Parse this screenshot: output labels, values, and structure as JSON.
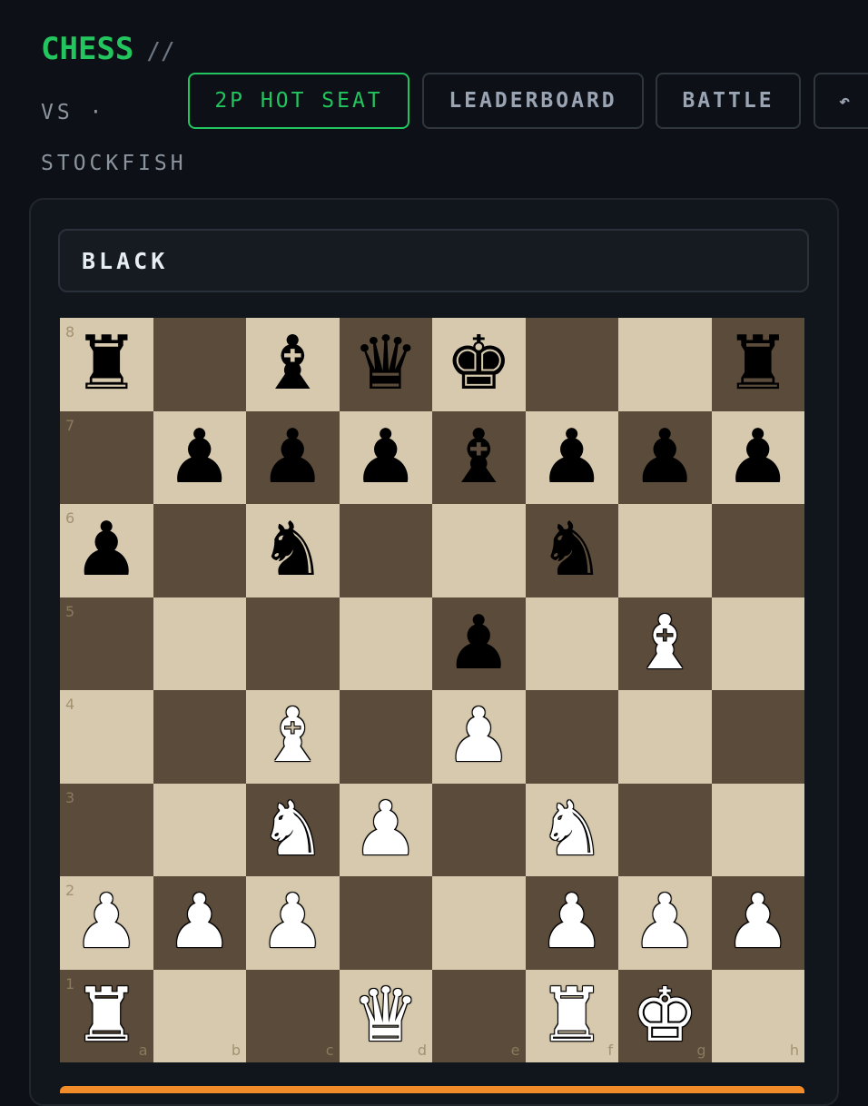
{
  "header": {
    "brand": "CHESS",
    "brand_sep": "//",
    "subtitle": "VS · STOCKFISH"
  },
  "nav": {
    "hot_seat": "2P HOT SEAT",
    "leaderboard": "LEADERBOARD",
    "battle": "BATTLE",
    "undo": "↶"
  },
  "game": {
    "turn_label": "BLACK"
  },
  "colors": {
    "accent": "#22c55e",
    "light_square": "#d6c9ad",
    "dark_square": "#5b4b3a",
    "warning": "#f28c28"
  },
  "board": {
    "files": [
      "a",
      "b",
      "c",
      "d",
      "e",
      "f",
      "g",
      "h"
    ],
    "ranks": [
      "8",
      "7",
      "6",
      "5",
      "4",
      "3",
      "2",
      "1"
    ],
    "rows": [
      [
        "r",
        "",
        "b",
        "q",
        "k",
        "",
        "",
        "r"
      ],
      [
        "",
        "p",
        "p",
        "p",
        "b",
        "p",
        "p",
        "p"
      ],
      [
        "p",
        "",
        "n",
        "",
        "",
        "n",
        "",
        ""
      ],
      [
        "",
        "",
        "",
        "",
        "p",
        "",
        "B",
        ""
      ],
      [
        "",
        "",
        "B",
        "",
        "P",
        "",
        "",
        ""
      ],
      [
        "",
        "",
        "N",
        "P",
        "",
        "N",
        "",
        ""
      ],
      [
        "P",
        "P",
        "P",
        "",
        "",
        "P",
        "P",
        "P"
      ],
      [
        "R",
        "",
        "",
        "Q",
        "",
        "R",
        "K",
        ""
      ]
    ]
  }
}
